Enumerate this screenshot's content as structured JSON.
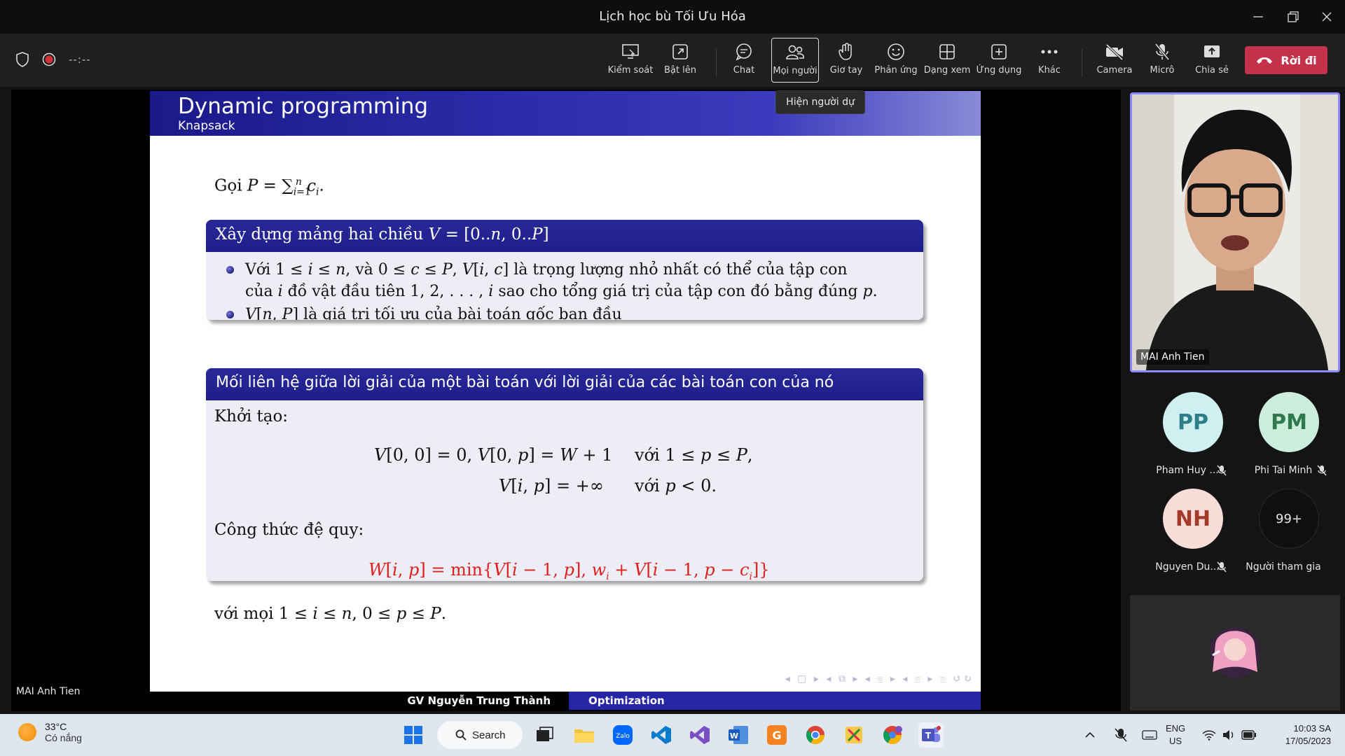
{
  "window": {
    "title": "Lịch học bù Tối Ưu Hóa"
  },
  "toolbar": {
    "timer": "--:--",
    "buttons": [
      {
        "label": "Kiểm soát",
        "icon": "screen-control-icon"
      },
      {
        "label": "Bật lên",
        "icon": "pop-out-icon"
      },
      {
        "label": "Chat",
        "icon": "chat-icon"
      },
      {
        "label": "Mọi người",
        "icon": "people-icon"
      },
      {
        "label": "Giơ tay",
        "icon": "raise-hand-icon"
      },
      {
        "label": "Phản ứng",
        "icon": "reaction-smiley-icon"
      },
      {
        "label": "Dạng xem",
        "icon": "view-grid-icon"
      },
      {
        "label": "Ứng dụng",
        "icon": "apps-plus-icon"
      },
      {
        "label": "Khác",
        "icon": "more-dots-icon"
      },
      {
        "label": "Camera",
        "icon": "camera-off-icon"
      },
      {
        "label": "Micrô",
        "icon": "mic-off-icon"
      },
      {
        "label": "Chia sẻ",
        "icon": "share-icon"
      }
    ],
    "leave_label": "Rời đi",
    "tooltip": "Hiện người dự",
    "colors": {
      "leave": "#c4314b",
      "active_border": "#e0e0e0"
    }
  },
  "slide": {
    "title": "Dynamic programming",
    "subtitle": "Knapsack",
    "intro_word": "Gọi",
    "block1": {
      "header_text": "Xây dựng mảng hai chiều",
      "bullet1_line1": "là trọng lượng nhỏ nhất có thể của tập con",
      "bullet1_line2_a": "của",
      "bullet1_line2_b": "đồ vật đầu tiên",
      "bullet1_line2_c": "sao cho tổng giá trị của tập con đó bằng đúng",
      "bullet2": "là giá trị tối ưu của bài toán gốc ban đầu"
    },
    "block2": {
      "header": "Mối liên hệ giữa lời giải của một bài toán với lời giải của các bài toán con của nó",
      "init_label": "Khởi tạo:",
      "with_word": "với",
      "recur_label": "Công thức đệ quy:",
      "final_word": "với mọi"
    },
    "nav_symbols": "◂ ▢ ▸ ◂ ⧉ ▸ ◂ ≣ ▸ ◂ ≣ ▸ ≣ ↺↻",
    "footer_left": "GV Nguyễn Trung Thành",
    "footer_right": "Optimization"
  },
  "stage": {
    "presenter_label": "MAI Anh Tien"
  },
  "participants": {
    "main_video_name": "MAI Anh Tien",
    "tiles": [
      {
        "initials": "PP",
        "name": "Pham Huy ...",
        "muted": true,
        "bg": "#cfeff0",
        "fg": "#2b7e86"
      },
      {
        "initials": "PM",
        "name": "Phi Tai Minh",
        "muted": true,
        "bg": "#cdeedd",
        "fg": "#2f7a4a"
      },
      {
        "initials": "NH",
        "name": "Nguyen Du...",
        "muted": true,
        "bg": "#f8dcd8",
        "fg": "#a33b2b"
      },
      {
        "initials": "99+",
        "name": "Người tham gia",
        "muted": false,
        "bg": "#0f0f0f",
        "fg": "#e6e6e6"
      }
    ]
  },
  "taskbar": {
    "weather_temp": "33°C",
    "weather_desc": "Có nắng",
    "search_label": "Search",
    "apps": [
      "windows-start-icon",
      "task-view-icon",
      "file-explorer-icon",
      "zalo-icon",
      "vscode-icon",
      "visual-studio-icon",
      "word-icon",
      "foxit-icon",
      "chrome-icon",
      "snipping-tool-icon",
      "chrome-profile-icon",
      "teams-icon"
    ],
    "lang_1": "ENG",
    "lang_2": "US",
    "time": "10:03 SA",
    "date": "17/05/2023"
  }
}
